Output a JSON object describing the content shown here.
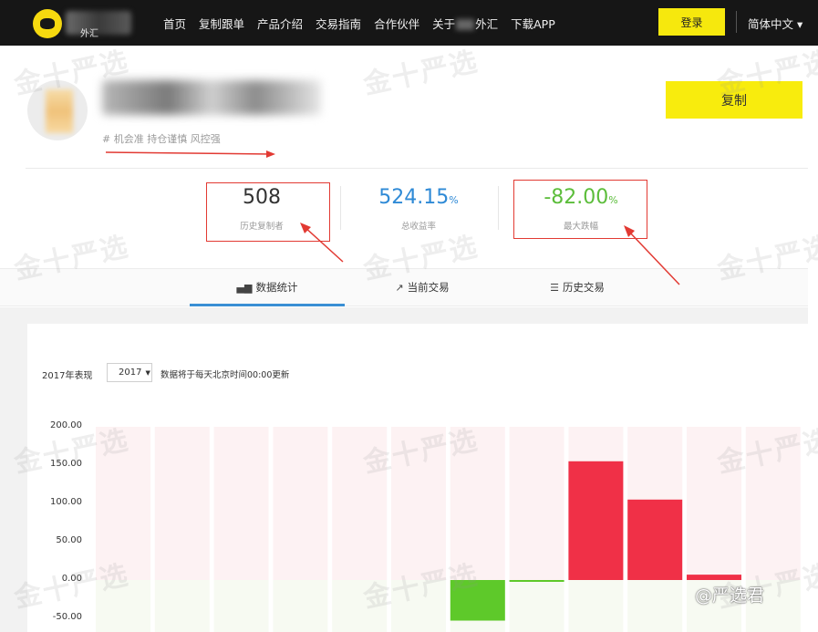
{
  "nav": {
    "logo_text": "外汇",
    "links": [
      "首页",
      "复制跟单",
      "产品介绍",
      "交易指南",
      "合作伙伴"
    ],
    "about_prefix": "关于",
    "about_suffix": "外汇",
    "download": "下载APP",
    "login": "登录",
    "language": "简体中文 ▾"
  },
  "profile": {
    "tags": "#  机会准  持仓谨慎  风控强",
    "copy_button": "复制"
  },
  "stats": [
    {
      "value": "508",
      "unit": "",
      "label": "历史复制者",
      "color": "#333333"
    },
    {
      "value": "524.15",
      "unit": "%",
      "label": "总收益率",
      "color": "#2f8ad6"
    },
    {
      "value": "-82.00",
      "unit": "%",
      "label": "最大跌幅",
      "color": "#5cbd3b"
    }
  ],
  "tabs": [
    {
      "icon": "bar-chart-icon",
      "label": "数据统计"
    },
    {
      "icon": "line-chart-icon",
      "label": "当前交易"
    },
    {
      "icon": "list-icon",
      "label": "历史交易"
    }
  ],
  "chart_controls": {
    "performance_label": "2017年表现",
    "year_value": "2017",
    "update_note": "数据将于每天北京时间00:00更新"
  },
  "watermark": "金十严选",
  "brand_mark": "@严选君",
  "colors": {
    "positive": "#f03047",
    "negative": "#5ec92a",
    "accent": "#f8ec0d",
    "tab_active": "#3a8fd4"
  },
  "chart_data": {
    "type": "bar",
    "y_tick_labels": [
      "200.00",
      "150.00",
      "100.00",
      "50.00",
      "0.00",
      "-50.00"
    ],
    "ylim": [
      -70,
      200
    ],
    "values": [
      0,
      0,
      0,
      0,
      0,
      0,
      -53,
      -2,
      155,
      105,
      7,
      0
    ]
  }
}
